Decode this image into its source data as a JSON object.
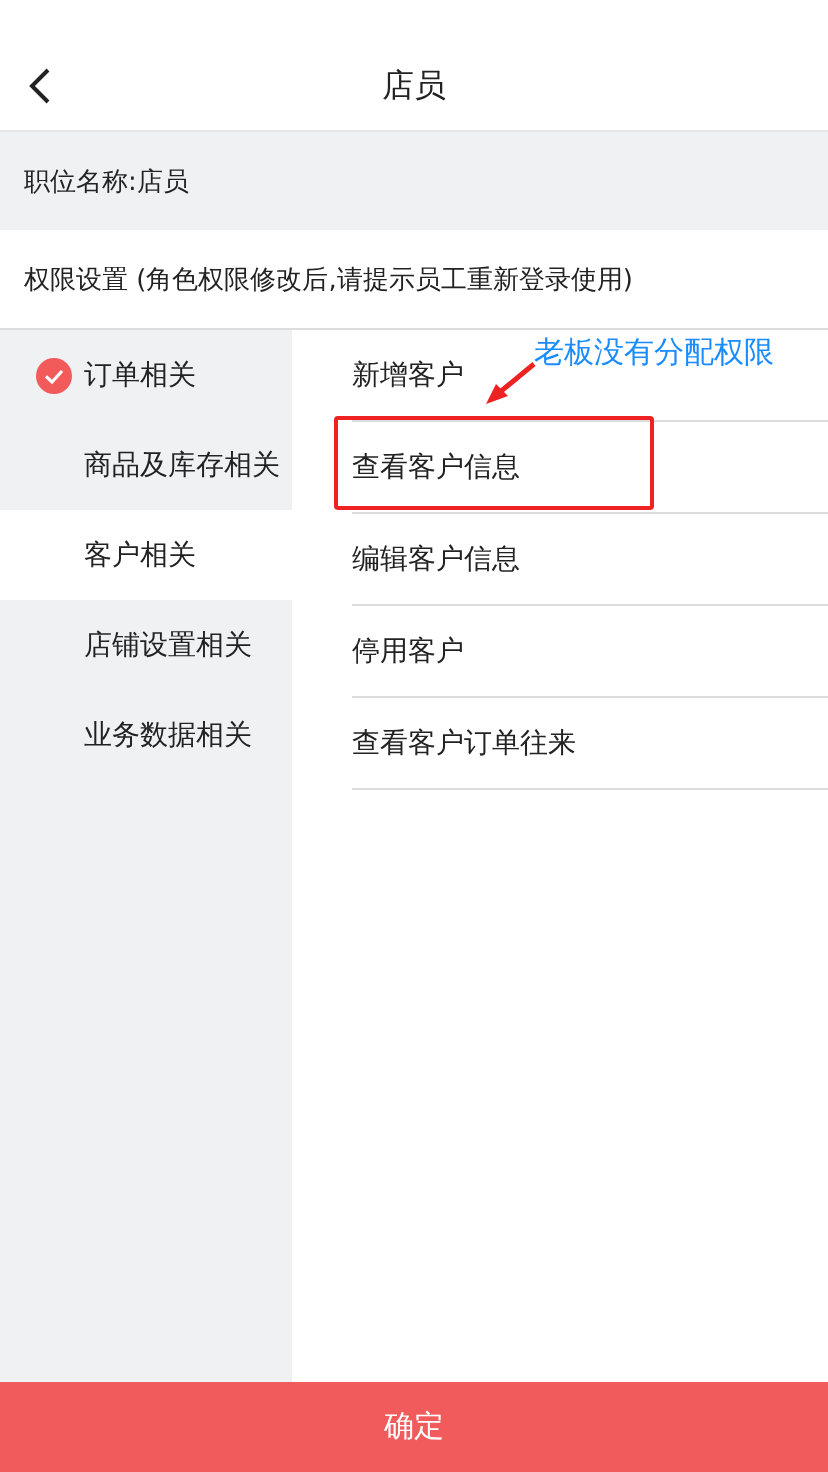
{
  "header": {
    "title": "店员"
  },
  "position_name": "职位名称:店员",
  "permission_hint": "权限设置 (角色权限修改后,请提示员工重新登录使用)",
  "categories": [
    {
      "label": "订单相关",
      "checked": true,
      "selected": false
    },
    {
      "label": "商品及库存相关",
      "checked": false,
      "selected": false
    },
    {
      "label": "客户相关",
      "checked": false,
      "selected": true
    },
    {
      "label": "店铺设置相关",
      "checked": false,
      "selected": false
    },
    {
      "label": "业务数据相关",
      "checked": false,
      "selected": false
    }
  ],
  "permissions": [
    {
      "label": "新增客户",
      "highlighted": false
    },
    {
      "label": "查看客户信息",
      "highlighted": true
    },
    {
      "label": "编辑客户信息",
      "highlighted": false
    },
    {
      "label": "停用客户",
      "highlighted": false
    },
    {
      "label": "查看客户订单往来",
      "highlighted": false
    }
  ],
  "annotation": {
    "text": "老板没有分配权限"
  },
  "confirm_button": "确定"
}
